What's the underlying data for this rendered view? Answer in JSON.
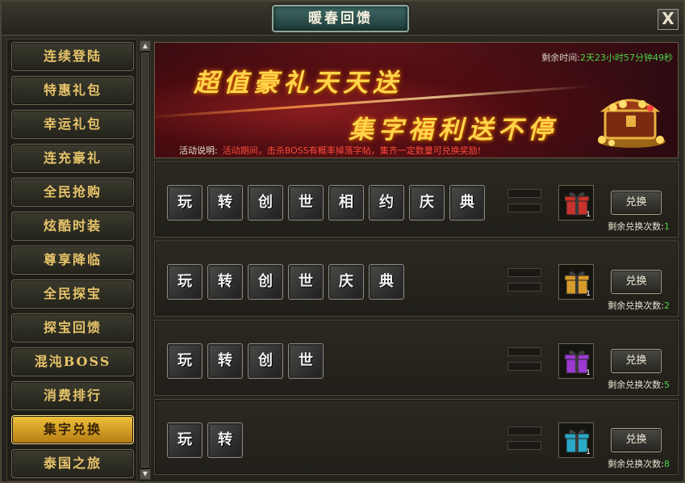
{
  "window": {
    "title": "暖春回馈",
    "close_label": "X"
  },
  "sidebar": {
    "items": [
      {
        "label": "连续登陆",
        "active": false
      },
      {
        "label": "特惠礼包",
        "active": false
      },
      {
        "label": "幸运礼包",
        "active": false
      },
      {
        "label": "连充豪礼",
        "active": false
      },
      {
        "label": "全民抢购",
        "active": false
      },
      {
        "label": "炫酷时装",
        "active": false
      },
      {
        "label": "尊享降临",
        "active": false
      },
      {
        "label": "全民探宝",
        "active": false
      },
      {
        "label": "探宝回馈",
        "active": false
      },
      {
        "label": "混沌BOSS",
        "active": false
      },
      {
        "label": "消费排行",
        "active": false
      },
      {
        "label": "集字兑换",
        "active": true
      },
      {
        "label": "泰国之旅",
        "active": false
      }
    ]
  },
  "banner": {
    "headline1": "超值豪礼天天送",
    "headline2": "集字福利送不停",
    "timer_label": "剩余时间:",
    "timer_value": "2天23小时57分钟49秒",
    "desc_label": "活动说明:",
    "desc_text": "活动期间，击杀BOSS有概率掉落字帖，集齐一定数量可兑换奖励!"
  },
  "rows": [
    {
      "chars": [
        "玩",
        "转",
        "创",
        "世",
        "相",
        "约",
        "庆",
        "典"
      ],
      "gift_color": "#c8322c",
      "gift_count": "1",
      "button_label": "兑换",
      "remain_label": "剩余兑换次数:",
      "remain_count": "1"
    },
    {
      "chars": [
        "玩",
        "转",
        "创",
        "世",
        "庆",
        "典"
      ],
      "gift_color": "#d89a2a",
      "gift_count": "1",
      "button_label": "兑换",
      "remain_label": "剩余兑换次数:",
      "remain_count": "2"
    },
    {
      "chars": [
        "玩",
        "转",
        "创",
        "世"
      ],
      "gift_color": "#9a3ad0",
      "gift_count": "1",
      "button_label": "兑换",
      "remain_label": "剩余兑换次数:",
      "remain_count": "5"
    },
    {
      "chars": [
        "玩",
        "转"
      ],
      "gift_color": "#2aa8c8",
      "gift_count": "1",
      "button_label": "兑换",
      "remain_label": "剩余兑换次数:",
      "remain_count": "8"
    }
  ],
  "colors": {
    "accent_gold": "#e7c46a",
    "active_tab": "#f0c23a",
    "timer_green": "#4bd64b",
    "desc_red": "#ff4a3a"
  }
}
